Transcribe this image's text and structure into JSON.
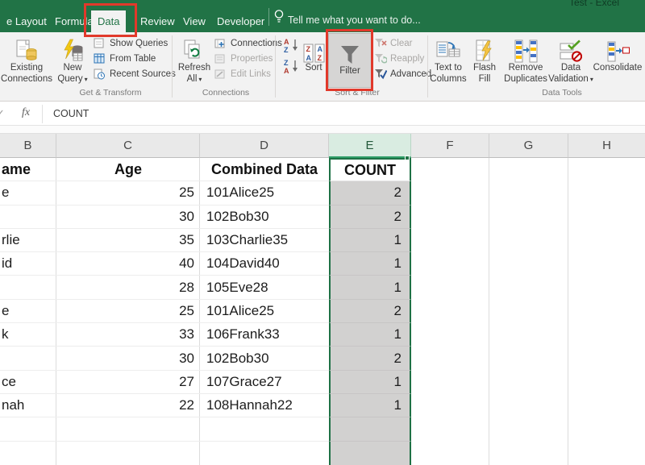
{
  "window": {
    "title": "Test - Excel"
  },
  "ui": {
    "caret": "▾",
    "fx": "fx",
    "check": "✓"
  },
  "tabs": [
    {
      "label": "e Layout"
    },
    {
      "label": "Formulas"
    },
    {
      "label": "Data",
      "active": true
    },
    {
      "label": "Review"
    },
    {
      "label": "View"
    },
    {
      "label": "Developer"
    }
  ],
  "tell_me": {
    "text": "Tell me what you want to do..."
  },
  "ribbon": {
    "get_transform": {
      "label": "Get & Transform",
      "existing_connections": {
        "l1": "Existing",
        "l2": "Connections"
      },
      "new_query": {
        "l1": "New",
        "l2": "Query"
      },
      "show_queries": "Show Queries",
      "from_table": "From Table",
      "recent_sources": "Recent Sources"
    },
    "connections": {
      "label": "Connections",
      "refresh_all": {
        "l1": "Refresh",
        "l2": "All"
      },
      "connections_btn": "Connections",
      "properties": "Properties",
      "edit_links": "Edit Links"
    },
    "sort_filter": {
      "label": "Sort & Filter",
      "sort": "Sort",
      "filter": "Filter",
      "clear": "Clear",
      "reapply": "Reapply",
      "advanced": "Advanced"
    },
    "data_tools": {
      "label": "Data Tools",
      "text_to_columns": {
        "l1": "Text to",
        "l2": "Columns"
      },
      "flash_fill": {
        "l1": "Flash",
        "l2": "Fill"
      },
      "remove_duplicates": {
        "l1": "Remove",
        "l2": "Duplicates"
      },
      "data_validation": {
        "l1": "Data",
        "l2": "Validation"
      },
      "consolidate": "Consolidate"
    }
  },
  "formula_bar": {
    "value": "COUNT"
  },
  "grid": {
    "columns": [
      "B",
      "C",
      "D",
      "E",
      "F",
      "G",
      "H"
    ],
    "selected_column": "E",
    "rows": [
      {
        "b": "ame",
        "c": "Age",
        "d": "Combined Data",
        "e": "COUNT"
      },
      {
        "b": "e",
        "c": "25",
        "d": "101Alice25",
        "e": "2"
      },
      {
        "b": "",
        "c": "30",
        "d": "102Bob30",
        "e": "2"
      },
      {
        "b": "rlie",
        "c": "35",
        "d": "103Charlie35",
        "e": "1"
      },
      {
        "b": "id",
        "c": "40",
        "d": "104David40",
        "e": "1"
      },
      {
        "b": "",
        "c": "28",
        "d": "105Eve28",
        "e": "1"
      },
      {
        "b": "e",
        "c": "25",
        "d": "101Alice25",
        "e": "2"
      },
      {
        "b": "k",
        "c": "33",
        "d": "106Frank33",
        "e": "1"
      },
      {
        "b": "",
        "c": "30",
        "d": "102Bob30",
        "e": "2"
      },
      {
        "b": "ce",
        "c": "27",
        "d": "107Grace27",
        "e": "1"
      },
      {
        "b": "nah",
        "c": "22",
        "d": "108Hannah22",
        "e": "1"
      },
      {
        "b": "",
        "c": "",
        "d": "",
        "e": ""
      },
      {
        "b": "",
        "c": "",
        "d": "",
        "e": ""
      }
    ]
  },
  "colors": {
    "excel_green": "#217346",
    "annotation_red": "#E1392B",
    "selection_gray": "#D2D1D0"
  }
}
